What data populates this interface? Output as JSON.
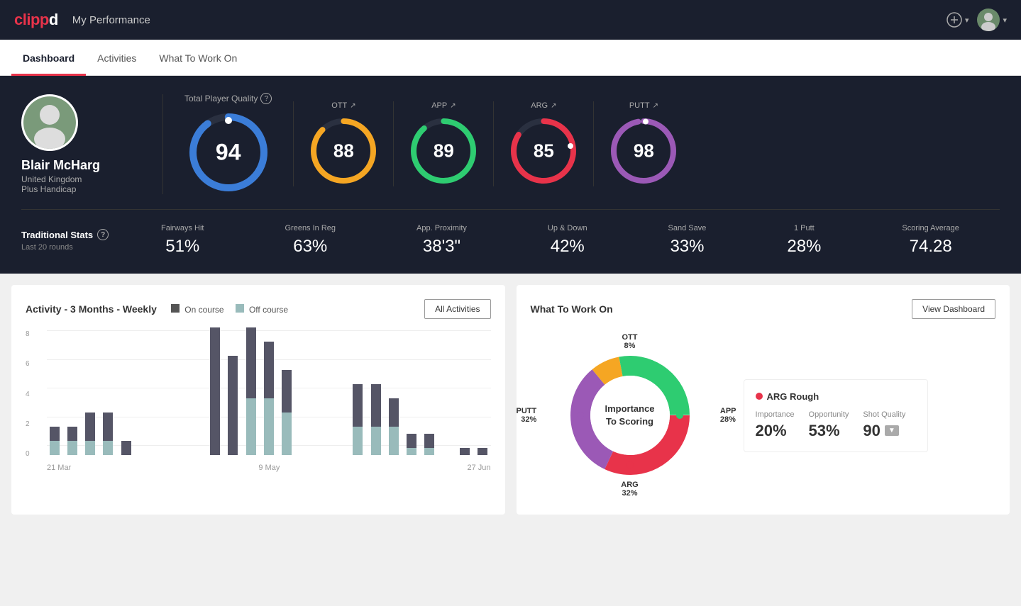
{
  "header": {
    "logo": "clipp",
    "logo_d": "d",
    "title": "My Performance",
    "add_icon": "⊕",
    "avatar_text": "👤"
  },
  "tabs": [
    {
      "label": "Dashboard",
      "active": true
    },
    {
      "label": "Activities",
      "active": false
    },
    {
      "label": "What To Work On",
      "active": false
    }
  ],
  "player": {
    "name": "Blair McHarg",
    "country": "United Kingdom",
    "handicap": "Plus Handicap"
  },
  "quality": {
    "title": "Total Player Quality",
    "main_score": "94",
    "scores": [
      {
        "label": "OTT",
        "value": "88",
        "color": "#f5a623",
        "bg": "#f5a623",
        "pct": 88
      },
      {
        "label": "APP",
        "value": "89",
        "color": "#2ecc71",
        "bg": "#2ecc71",
        "pct": 89
      },
      {
        "label": "ARG",
        "value": "85",
        "color": "#e8334a",
        "bg": "#e8334a",
        "pct": 85
      },
      {
        "label": "PUTT",
        "value": "98",
        "color": "#9b59b6",
        "bg": "#9b59b6",
        "pct": 98
      }
    ]
  },
  "trad_stats": {
    "title": "Traditional Stats",
    "info": "?",
    "subtitle": "Last 20 rounds",
    "items": [
      {
        "label": "Fairways Hit",
        "value": "51%"
      },
      {
        "label": "Greens In Reg",
        "value": "63%"
      },
      {
        "label": "App. Proximity",
        "value": "38'3\""
      },
      {
        "label": "Up & Down",
        "value": "42%"
      },
      {
        "label": "Sand Save",
        "value": "33%"
      },
      {
        "label": "1 Putt",
        "value": "28%"
      },
      {
        "label": "Scoring Average",
        "value": "74.28"
      }
    ]
  },
  "activity_chart": {
    "title": "Activity - 3 Months - Weekly",
    "legend": {
      "on_course": "On course",
      "off_course": "Off course"
    },
    "button": "All Activities",
    "x_labels": [
      "21 Mar",
      "9 May",
      "27 Jun"
    ],
    "y_labels": [
      "8",
      "6",
      "4",
      "2",
      "0"
    ],
    "bars": [
      {
        "on": 1,
        "off": 1
      },
      {
        "on": 1,
        "off": 1
      },
      {
        "on": 2,
        "off": 1
      },
      {
        "on": 2,
        "off": 1
      },
      {
        "on": 1,
        "off": 0
      },
      {
        "on": 0,
        "off": 0
      },
      {
        "on": 0,
        "off": 0
      },
      {
        "on": 0,
        "off": 0
      },
      {
        "on": 0,
        "off": 0
      },
      {
        "on": 9,
        "off": 0
      },
      {
        "on": 7,
        "off": 0
      },
      {
        "on": 5,
        "off": 4
      },
      {
        "on": 4,
        "off": 4
      },
      {
        "on": 3,
        "off": 3
      },
      {
        "on": 0,
        "off": 0
      },
      {
        "on": 0,
        "off": 0
      },
      {
        "on": 0,
        "off": 0
      },
      {
        "on": 3,
        "off": 2
      },
      {
        "on": 3,
        "off": 2
      },
      {
        "on": 2,
        "off": 2
      },
      {
        "on": 1,
        "off": 0.5
      },
      {
        "on": 1,
        "off": 0.5
      },
      {
        "on": 0,
        "off": 0
      },
      {
        "on": 0.5,
        "off": 0
      },
      {
        "on": 0.5,
        "off": 0
      }
    ]
  },
  "work_on": {
    "title": "What To Work On",
    "button": "View Dashboard",
    "donut": {
      "center_line1": "Importance",
      "center_line2": "To Scoring",
      "segments": [
        {
          "label": "OTT",
          "value": "8%",
          "color": "#f5a623",
          "pct": 8
        },
        {
          "label": "APP",
          "value": "28%",
          "color": "#2ecc71",
          "pct": 28
        },
        {
          "label": "ARG",
          "value": "32%",
          "color": "#e8334a",
          "pct": 32
        },
        {
          "label": "PUTT",
          "value": "32%",
          "color": "#9b59b6",
          "pct": 32
        }
      ]
    },
    "insight": {
      "title": "ARG Rough",
      "dot_color": "#e8334a",
      "metrics": [
        {
          "label": "Importance",
          "value": "20%"
        },
        {
          "label": "Opportunity",
          "value": "53%"
        },
        {
          "label": "Shot Quality",
          "value": "90"
        }
      ]
    }
  }
}
